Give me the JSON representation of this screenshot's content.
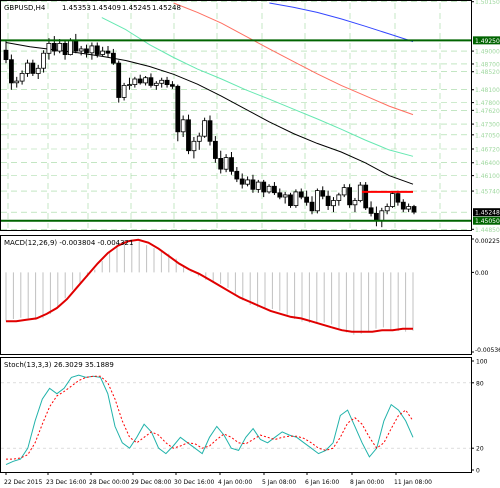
{
  "chart_data": [
    {
      "type": "candlestick",
      "title": "GBPUSD,H4",
      "ohlc_header": [
        "1.45353",
        "1.45409",
        "1.45245",
        "1.45248"
      ],
      "ylim": [
        1.4488,
        1.5012
      ],
      "price_labels": [
        "1.50150",
        "1.49250",
        "1.49000",
        "1.48700",
        "1.48520",
        "1.48100",
        "1.47800",
        "1.47620",
        "1.47300",
        "1.47050",
        "1.46720",
        "1.46400",
        "1.46100",
        "1.45740",
        "1.45248",
        "1.45050",
        "1.44850"
      ],
      "current_price": "1.45248",
      "horizontal_levels": [
        {
          "price": 1.4925,
          "label": "1.49250",
          "color": "#006400"
        },
        {
          "price": 1.4505,
          "label": "1.45050",
          "color": "#006400"
        },
        {
          "price": 1.4572,
          "label": "",
          "color": "#ff0000",
          "segment": true
        }
      ],
      "moving_averages": [
        {
          "color": "#000000",
          "values": [
            1.492,
            1.491,
            1.4903,
            1.4896,
            1.4888,
            1.4878,
            1.4864,
            1.4846,
            1.4823,
            1.4795,
            1.4765,
            1.4735,
            1.4708,
            1.4685,
            1.4665,
            1.464,
            1.461,
            1.459
          ]
        },
        {
          "color": "#66e8b2",
          "values": [
            null,
            null,
            null,
            null,
            1.4978,
            1.495,
            1.4915,
            1.4885,
            1.4858,
            1.4835,
            1.481,
            1.4788,
            1.4765,
            1.4742,
            1.4718,
            1.4693,
            1.467,
            1.4655
          ]
        },
        {
          "color": "#ff6f61",
          "values": [
            null,
            null,
            null,
            null,
            null,
            null,
            null,
            1.5012,
            1.499,
            1.4965,
            1.4935,
            1.4905,
            1.4876,
            1.4847,
            1.482,
            1.4796,
            1.4772,
            1.4752
          ]
        },
        {
          "color": "#3346ff",
          "values": [
            null,
            null,
            null,
            null,
            null,
            null,
            null,
            null,
            null,
            null,
            null,
            1.5012,
            1.5002,
            1.499,
            1.4975,
            1.4958,
            1.494,
            1.4922
          ]
        }
      ],
      "candles": [
        [
          1.4902,
          1.4925,
          1.4872,
          1.488
        ],
        [
          1.488,
          1.4892,
          1.481,
          1.4826
        ],
        [
          1.4826,
          1.484,
          1.4815,
          1.483
        ],
        [
          1.483,
          1.4855,
          1.4822,
          1.4848
        ],
        [
          1.4848,
          1.488,
          1.484,
          1.4872
        ],
        [
          1.4872,
          1.488,
          1.4842,
          1.4848
        ],
        [
          1.4848,
          1.4868,
          1.4835,
          1.486
        ],
        [
          1.486,
          1.4902,
          1.485,
          1.4895
        ],
        [
          1.4895,
          1.493,
          1.488,
          1.4918
        ],
        [
          1.4918,
          1.4935,
          1.489,
          1.49
        ],
        [
          1.49,
          1.4928,
          1.4895,
          1.4918
        ],
        [
          1.4918,
          1.4925,
          1.488,
          1.4892
        ],
        [
          1.4892,
          1.493,
          1.489,
          1.4925
        ],
        [
          1.4925,
          1.494,
          1.4895,
          1.49
        ],
        [
          1.49,
          1.4912,
          1.489,
          1.4905
        ],
        [
          1.4905,
          1.4915,
          1.4885,
          1.4896
        ],
        [
          1.4896,
          1.492,
          1.488,
          1.4912
        ],
        [
          1.4912,
          1.492,
          1.4885,
          1.4892
        ],
        [
          1.4892,
          1.491,
          1.4888,
          1.49
        ],
        [
          1.49,
          1.4912,
          1.4885,
          1.4895
        ],
        [
          1.4895,
          1.4905,
          1.4868,
          1.4872
        ],
        [
          1.4872,
          1.4878,
          1.478,
          1.4792
        ],
        [
          1.4792,
          1.4826,
          1.4785,
          1.482
        ],
        [
          1.482,
          1.4838,
          1.481,
          1.4822
        ],
        [
          1.4822,
          1.484,
          1.4815,
          1.4835
        ],
        [
          1.4835,
          1.4845,
          1.4822,
          1.4826
        ],
        [
          1.4826,
          1.4842,
          1.482,
          1.4838
        ],
        [
          1.4838,
          1.4848,
          1.4815,
          1.482
        ],
        [
          1.482,
          1.483,
          1.481,
          1.4825
        ],
        [
          1.4825,
          1.4838,
          1.4815,
          1.4832
        ],
        [
          1.4832,
          1.484,
          1.4815,
          1.4822
        ],
        [
          1.4822,
          1.483,
          1.4812,
          1.4818
        ],
        [
          1.4818,
          1.4822,
          1.469,
          1.4712
        ],
        [
          1.4712,
          1.475,
          1.47,
          1.474
        ],
        [
          1.474,
          1.4752,
          1.466,
          1.4668
        ],
        [
          1.4668,
          1.47,
          1.465,
          1.469
        ],
        [
          1.469,
          1.471,
          1.467,
          1.4702
        ],
        [
          1.4702,
          1.4745,
          1.4698,
          1.4738
        ],
        [
          1.4738,
          1.475,
          1.468,
          1.469
        ],
        [
          1.469,
          1.4702,
          1.464,
          1.465
        ],
        [
          1.465,
          1.4668,
          1.4615,
          1.4625
        ],
        [
          1.4625,
          1.466,
          1.4618,
          1.4652
        ],
        [
          1.4652,
          1.4665,
          1.4612,
          1.462
        ],
        [
          1.462,
          1.463,
          1.4595,
          1.4602
        ],
        [
          1.4602,
          1.4615,
          1.458,
          1.459
        ],
        [
          1.459,
          1.4608,
          1.4585,
          1.46
        ],
        [
          1.46,
          1.4612,
          1.457,
          1.4578
        ],
        [
          1.4578,
          1.46,
          1.457,
          1.4595
        ],
        [
          1.4595,
          1.46,
          1.456,
          1.4572
        ],
        [
          1.4572,
          1.459,
          1.4568,
          1.4585
        ],
        [
          1.4585,
          1.4595,
          1.4565,
          1.457
        ],
        [
          1.457,
          1.458,
          1.4555,
          1.456
        ],
        [
          1.456,
          1.4572,
          1.4545,
          1.4565
        ],
        [
          1.4565,
          1.457,
          1.4535,
          1.454
        ],
        [
          1.454,
          1.4578,
          1.4535,
          1.4572
        ],
        [
          1.4572,
          1.458,
          1.4555,
          1.456
        ],
        [
          1.456,
          1.4575,
          1.454,
          1.4548
        ],
        [
          1.4548,
          1.4562,
          1.452,
          1.4528
        ],
        [
          1.4528,
          1.458,
          1.4522,
          1.4575
        ],
        [
          1.4575,
          1.4585,
          1.4555,
          1.4562
        ],
        [
          1.4562,
          1.4575,
          1.453,
          1.454
        ],
        [
          1.454,
          1.456,
          1.4525,
          1.4552
        ],
        [
          1.4552,
          1.457,
          1.454,
          1.4565
        ],
        [
          1.4565,
          1.459,
          1.456,
          1.4582
        ],
        [
          1.4582,
          1.459,
          1.4535,
          1.4542
        ],
        [
          1.4542,
          1.4558,
          1.4525,
          1.4552
        ],
        [
          1.4552,
          1.4595,
          1.4548,
          1.4588
        ],
        [
          1.4588,
          1.4595,
          1.453,
          1.4535
        ],
        [
          1.4535,
          1.455,
          1.4515,
          1.4522
        ],
        [
          1.4522,
          1.4538,
          1.4492,
          1.4505
        ],
        [
          1.4505,
          1.4535,
          1.449,
          1.4528
        ],
        [
          1.4528,
          1.4545,
          1.452,
          1.4538
        ],
        [
          1.4538,
          1.4572,
          1.4535,
          1.4568
        ],
        [
          1.4568,
          1.4575,
          1.454,
          1.4548
        ],
        [
          1.4548,
          1.4555,
          1.4525,
          1.4532
        ],
        [
          1.4532,
          1.4545,
          1.4525,
          1.4538
        ],
        [
          1.4538,
          1.4542,
          1.452,
          1.4525
        ]
      ]
    },
    {
      "type": "line",
      "title": "MACD(12,26,9) -0.003804 -0.004321",
      "y_labels": [
        "0.002251",
        "0.00",
        "-0.005368"
      ],
      "ylim": [
        -0.005368,
        0.002251
      ],
      "histogram_color": "#c0c0c0",
      "line_color": "#e00000",
      "signal": [
        -0.0033,
        -0.0033,
        -0.0032,
        -0.0031,
        -0.0028,
        -0.0024,
        -0.0018,
        -0.001,
        -0.0002,
        0.0006,
        0.0013,
        0.0018,
        0.0021,
        0.0022,
        0.002,
        0.0016,
        0.0011,
        0.0006,
        0.0002,
        -0.0001,
        -0.0005,
        -0.0009,
        -0.0013,
        -0.0017,
        -0.002,
        -0.0023,
        -0.0026,
        -0.0028,
        -0.003,
        -0.0031,
        -0.0033,
        -0.0035,
        -0.0037,
        -0.0039,
        -0.004,
        -0.004,
        -0.004,
        -0.0039,
        -0.0039,
        -0.0038,
        -0.0038
      ]
    },
    {
      "type": "line",
      "title": "Stoch(13,3,3) 26.3029 35.1889",
      "y_labels": [
        "100",
        "80",
        "20",
        "0"
      ],
      "ylim": [
        0,
        100
      ],
      "main_color": "#20b2aa",
      "signal_color": "#ff0000",
      "main": [
        5,
        8,
        10,
        20,
        45,
        65,
        75,
        70,
        75,
        85,
        87,
        85,
        86,
        85,
        70,
        40,
        25,
        20,
        30,
        42,
        35,
        20,
        15,
        22,
        30,
        25,
        20,
        15,
        30,
        40,
        32,
        20,
        18,
        30,
        38,
        28,
        25,
        30,
        35,
        32,
        30,
        25,
        20,
        15,
        18,
        25,
        50,
        55,
        40,
        25,
        12,
        20,
        45,
        60,
        55,
        45,
        30
      ],
      "signal": [
        10,
        10,
        11,
        14,
        25,
        42,
        58,
        68,
        72,
        77,
        82,
        85,
        86,
        86,
        80,
        65,
        45,
        30,
        25,
        30,
        35,
        32,
        25,
        20,
        22,
        25,
        24,
        20,
        22,
        28,
        33,
        30,
        25,
        24,
        28,
        32,
        30,
        28,
        30,
        31,
        31,
        29,
        25,
        20,
        18,
        20,
        30,
        43,
        48,
        42,
        30,
        20,
        25,
        38,
        50,
        55,
        45
      ]
    }
  ],
  "x_labels": [
    "22 Dec 2015",
    "23 Dec 16:00",
    "28 Dec 00:00",
    "29 Dec 08:00",
    "30 Dec 16:00",
    "4 Jan 00:00",
    "5 Jan 08:00",
    "6 Jan 16:00",
    "8 Jan 00:00",
    "11 Jan 08:00"
  ],
  "colors": {
    "bull": "#ffffff",
    "bear": "#000000",
    "grid": "#9fd89f",
    "axis": "#000000"
  }
}
